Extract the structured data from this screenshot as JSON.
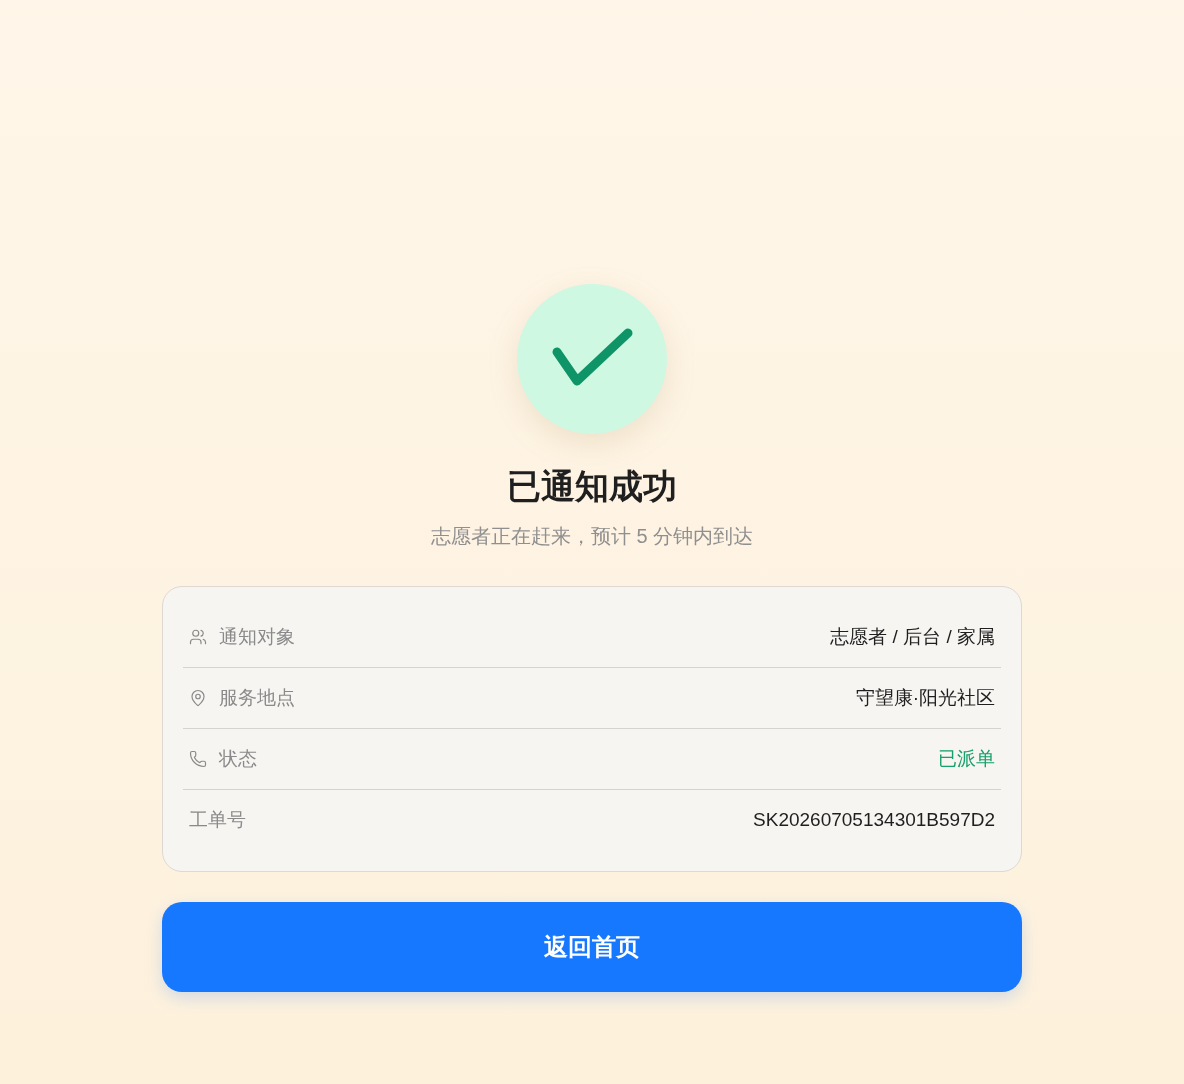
{
  "result": {
    "title": "已通知成功",
    "subtitle": "志愿者正在赶来，预计 5 分钟内到达"
  },
  "details": [
    {
      "kind": "contacts",
      "label": "通知对象",
      "value": "志愿者 / 后台 / 家属"
    },
    {
      "kind": "place",
      "label": "服务地点",
      "value": "守望康·阳光社区"
    },
    {
      "kind": "status",
      "label": "状态",
      "value": "已派单"
    },
    {
      "kind": "plain",
      "label": "工单号",
      "value": "SK20260705134301B597D2"
    }
  ],
  "buttons": [
    {
      "label": "返回首页"
    }
  ]
}
